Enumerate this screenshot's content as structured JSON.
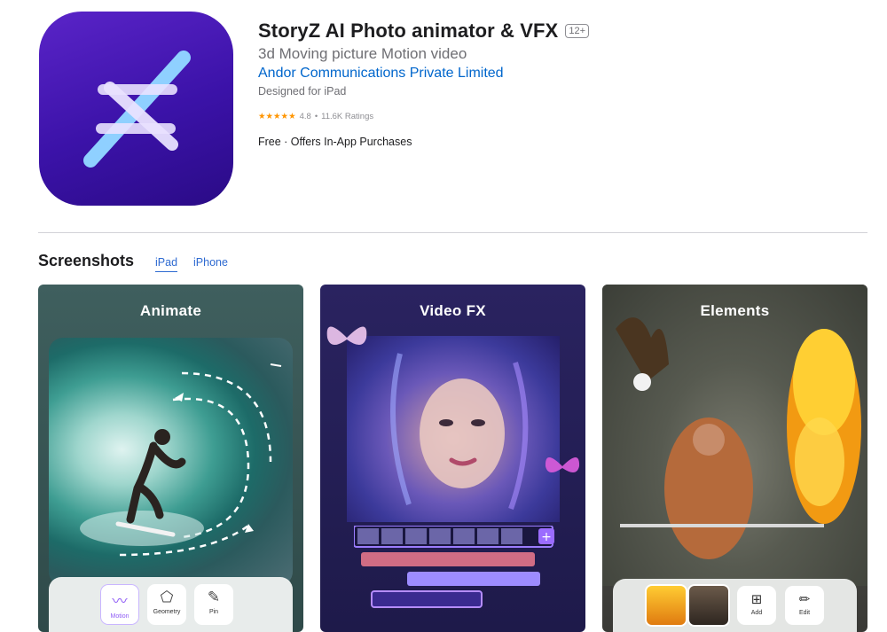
{
  "app": {
    "title": "StoryZ AI Photo animator & VFX",
    "age_rating": "12+",
    "subtitle": "3d Moving picture Motion video",
    "developer": "Andor Communications Private Limited",
    "designed_for": "Designed for iPad",
    "rating": {
      "stars": "★★★★★",
      "value": "4.8",
      "separator": "•",
      "count": "11.6K Ratings"
    },
    "price": "Free · Offers In-App Purchases",
    "icon": "storyz-logo-icon",
    "accent_color": "#0066cc"
  },
  "screenshots": {
    "title": "Screenshots",
    "tabs": [
      {
        "label": "iPad",
        "selected": true
      },
      {
        "label": "iPhone",
        "selected": false
      }
    ],
    "items": [
      {
        "label": "Animate",
        "tools": [
          {
            "label": "Motion",
            "icon": "motion-icon",
            "selected": true
          },
          {
            "label": "Geometry",
            "icon": "geometry-icon",
            "selected": false
          },
          {
            "label": "Pin",
            "icon": "pin-icon",
            "selected": false
          }
        ]
      },
      {
        "label": "Video FX"
      },
      {
        "label": "Elements",
        "tools": [
          {
            "label": "Add",
            "icon": "add-icon"
          },
          {
            "label": "Edit",
            "icon": "edit-icon"
          }
        ]
      }
    ]
  }
}
